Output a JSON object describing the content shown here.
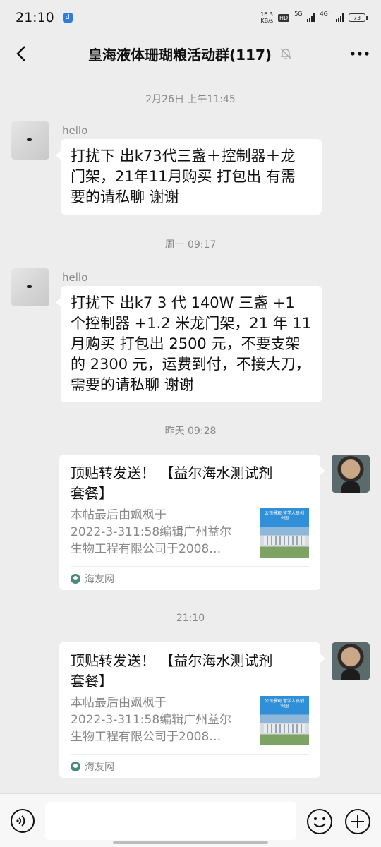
{
  "status_bar": {
    "time": "21:10",
    "app_icon_glyph": "d",
    "net_speed_value": "16.3",
    "net_speed_unit": "KB/s",
    "hd_label": "HD",
    "sim1_label": "5G",
    "sim2_label": "4G⁺",
    "battery": "73"
  },
  "header": {
    "title": "皇海液体珊瑚粮活动群(117)",
    "icons": [
      "back-arrow-icon",
      "mute-bell-icon",
      "more-dots-icon"
    ]
  },
  "messages": [
    {
      "type": "timestamp",
      "text": "2月26日 上午11:45"
    },
    {
      "type": "text",
      "side": "left",
      "sender": "hello",
      "lines": [
        "打扰下 出k73代三盏＋控制器＋龙",
        "门架，21年11月购买 打包出 有需",
        "要的请私聊 谢谢"
      ]
    },
    {
      "type": "timestamp",
      "text": "周一 09:17"
    },
    {
      "type": "text",
      "side": "left",
      "sender": "hello",
      "lines": [
        "打扰下 出k7 3 代 140W 三盏 +1",
        "个控制器 +1.2 米龙门架，21 年 11",
        "月购买 打包出 2500 元，不要支架",
        "的 2300 元，运费到付，不接大刀，",
        "需要的请私聊 谢谢"
      ]
    },
    {
      "type": "timestamp",
      "text": "昨天 09:28"
    },
    {
      "type": "card",
      "side": "right",
      "title_lines": [
        "顶贴转发送！ 【益尔海水测试剂",
        "套餐】"
      ],
      "desc_lines": [
        "本帖最后由飒枫于",
        "2022-3-311:58编辑广州益尔",
        "生物工程有限公司于2008…"
      ],
      "thumb_text": "公司景观 留学人员创业园",
      "source": "海友网"
    },
    {
      "type": "timestamp",
      "text": "21:10"
    },
    {
      "type": "card",
      "side": "right",
      "title_lines": [
        "顶贴转发送！ 【益尔海水测试剂",
        "套餐】"
      ],
      "desc_lines": [
        "本帖最后由飒枫于",
        "2022-3-311:58编辑广州益尔",
        "生物工程有限公司于2008…"
      ],
      "thumb_text": "公司景观 留学人员创业园",
      "source": "海友网"
    }
  ],
  "input_bar": {
    "placeholder": "",
    "icons": [
      "voice-icon",
      "emoji-icon",
      "plus-icon"
    ]
  }
}
